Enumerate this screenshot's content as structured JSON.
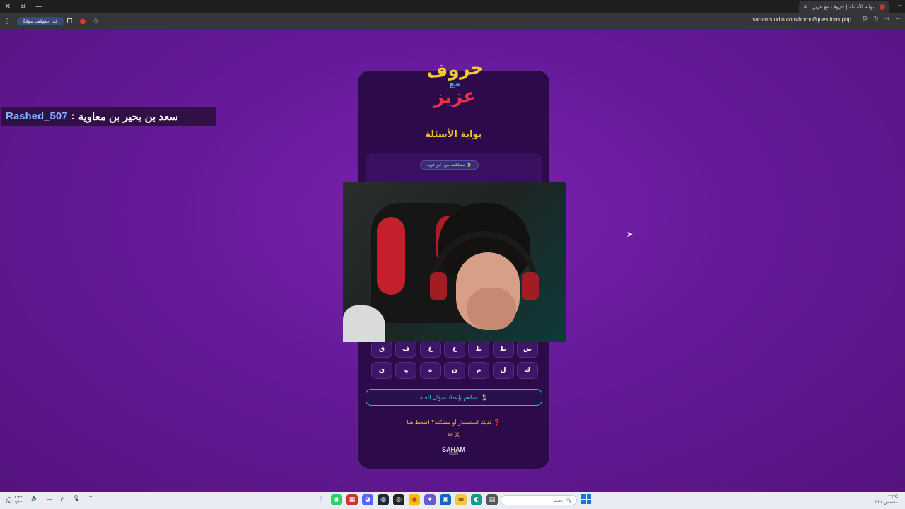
{
  "browser": {
    "tab_title": "بوابة الأسئلة | حروف مع عزيز",
    "url": "sahamstudio.com/horoof/questions.php",
    "profile_label": "متوقف مؤقتًا",
    "profile_initial": "ف"
  },
  "overlay": {
    "username": "Rashed_507",
    "separator": ":",
    "question": "سعد بن بحير بن معاوية"
  },
  "logo": {
    "line1": "حروف",
    "line2": "مع",
    "line3": "عزيز"
  },
  "page": {
    "title": "بوابة الأسئلة",
    "contributor": "مساهمة من: ابو عويد",
    "contribute_button": "ساهم بإعداد سؤال للعبة",
    "help_text": "لديك استفسار أو مشكلة؟ اضغط هنا",
    "socials": "✉ X",
    "brand": "SAHAM",
    "brand_sub": "studio"
  },
  "keyboard": {
    "row1": [
      "ض",
      "ط",
      "ظ",
      "ع",
      "غ",
      "ف",
      "ق"
    ],
    "row2": [
      "ك",
      "ل",
      "م",
      "ن",
      "ه",
      "و",
      "ي"
    ]
  },
  "taskbar": {
    "search_placeholder": "بحث",
    "time": "٠٧:٢٢ ص",
    "date": "٢٧/٠٦/٢٣",
    "weather_temp": "٢٦°C",
    "weather_desc": "مشمس غالبًا",
    "lang": "ع"
  }
}
